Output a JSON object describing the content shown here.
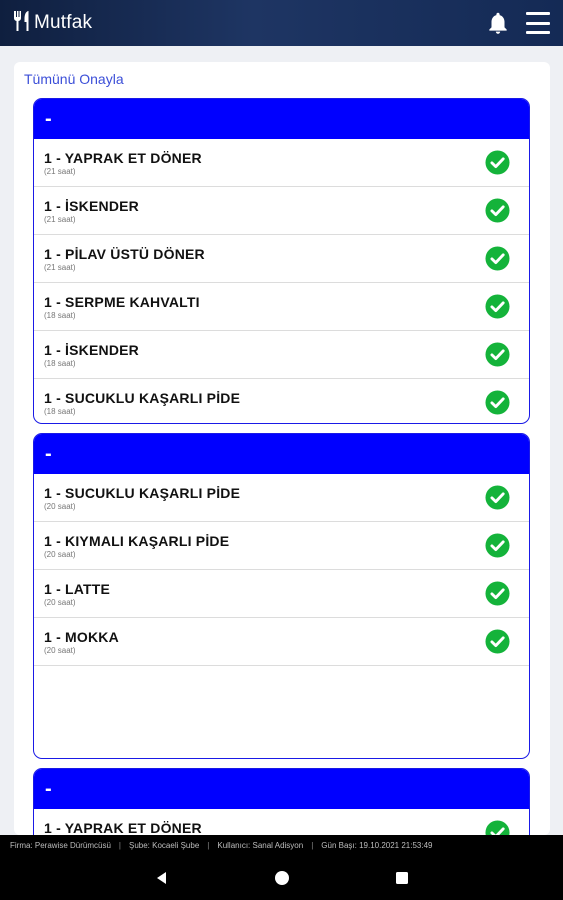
{
  "app": {
    "title": "Mutfak"
  },
  "toolbar": {
    "approve_all": "Tümünü Onayla"
  },
  "groups": [
    {
      "header": "-",
      "items": [
        {
          "name": "1 - YAPRAK ET DÖNER",
          "time": "(21 saat)"
        },
        {
          "name": "1 - İSKENDER",
          "time": "(21 saat)"
        },
        {
          "name": "1 - PİLAV ÜSTÜ DÖNER",
          "time": "(21 saat)"
        },
        {
          "name": "1 - SERPME KAHVALTI",
          "time": "(18 saat)"
        },
        {
          "name": "1 - İSKENDER",
          "time": "(18 saat)"
        },
        {
          "name": "1 - SUCUKLU KAŞARLI PİDE",
          "time": "(18 saat)"
        }
      ]
    },
    {
      "header": "-",
      "items": [
        {
          "name": "1 - SUCUKLU KAŞARLI PİDE",
          "time": "(20 saat)"
        },
        {
          "name": "1 - KIYMALI KAŞARLI PİDE",
          "time": "(20 saat)"
        },
        {
          "name": "1 - LATTE",
          "time": "(20 saat)"
        },
        {
          "name": "1 - MOKKA",
          "time": "(20 saat)"
        }
      ]
    },
    {
      "header": "-",
      "items": [
        {
          "name": "1 - YAPRAK ET DÖNER",
          "time": ""
        }
      ]
    }
  ],
  "status": {
    "firma": "Firma: Perawise Dürümcüsü",
    "sube": "Şube: Kocaeli Şube",
    "kullanici": "Kullanıcı: Sanal Adisyon",
    "gun_basi": "Gün Başı: 19.10.2021 21:53:49",
    "separator": "|"
  },
  "colors": {
    "accent": "#0000ff",
    "check": "#14b33a",
    "appbar": "#1a2f5a"
  },
  "icons": {
    "logo": "fork-knife-icon",
    "bell": "bell-icon",
    "menu": "hamburger-menu-icon",
    "check": "check-circle-icon"
  }
}
